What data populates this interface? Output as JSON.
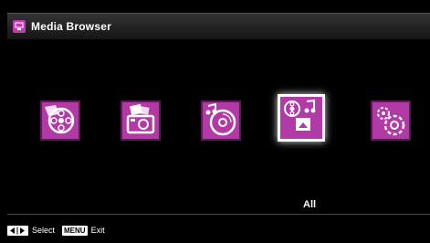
{
  "window": {
    "title": "Media Browser",
    "title_icon": "media-browser-icon"
  },
  "tiles": [
    {
      "name": "videos",
      "icon": "film-reel-icon",
      "selected": false
    },
    {
      "name": "photos",
      "icon": "camera-photo-icon",
      "selected": false
    },
    {
      "name": "music",
      "icon": "music-disc-icon",
      "selected": false
    },
    {
      "name": "all",
      "icon": "all-media-icon",
      "selected": true,
      "label": "All"
    },
    {
      "name": "settings",
      "icon": "gears-icon",
      "selected": false
    }
  ],
  "footer": {
    "select_label": "Select",
    "menu_key": "MENU",
    "exit_label": "Exit"
  },
  "colors": {
    "accent": "#b23aa6",
    "background": "#000000"
  }
}
